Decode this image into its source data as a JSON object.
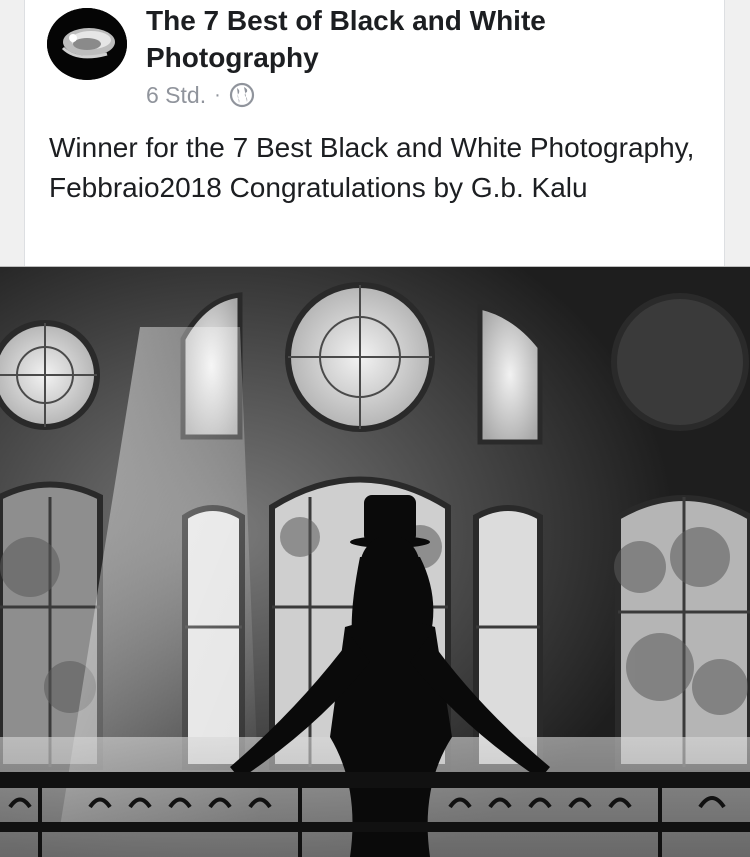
{
  "post": {
    "page_name": "The 7 Best of Black and White Photography",
    "timestamp": "6 Std.",
    "separator": "·",
    "privacy_icon": "globe-icon",
    "text": "Winner for the 7 Best Black and White Photography, Febbraio2018 Congratulations by G.b. Kalu"
  },
  "media": {
    "subject": "black-and-white photo of silhouetted woman in top hat at balcony railing"
  },
  "colors": {
    "name_text": "#1c1e21",
    "meta_text": "#90949c",
    "card_bg": "#ffffff",
    "page_bg": "#f0f0f0"
  }
}
